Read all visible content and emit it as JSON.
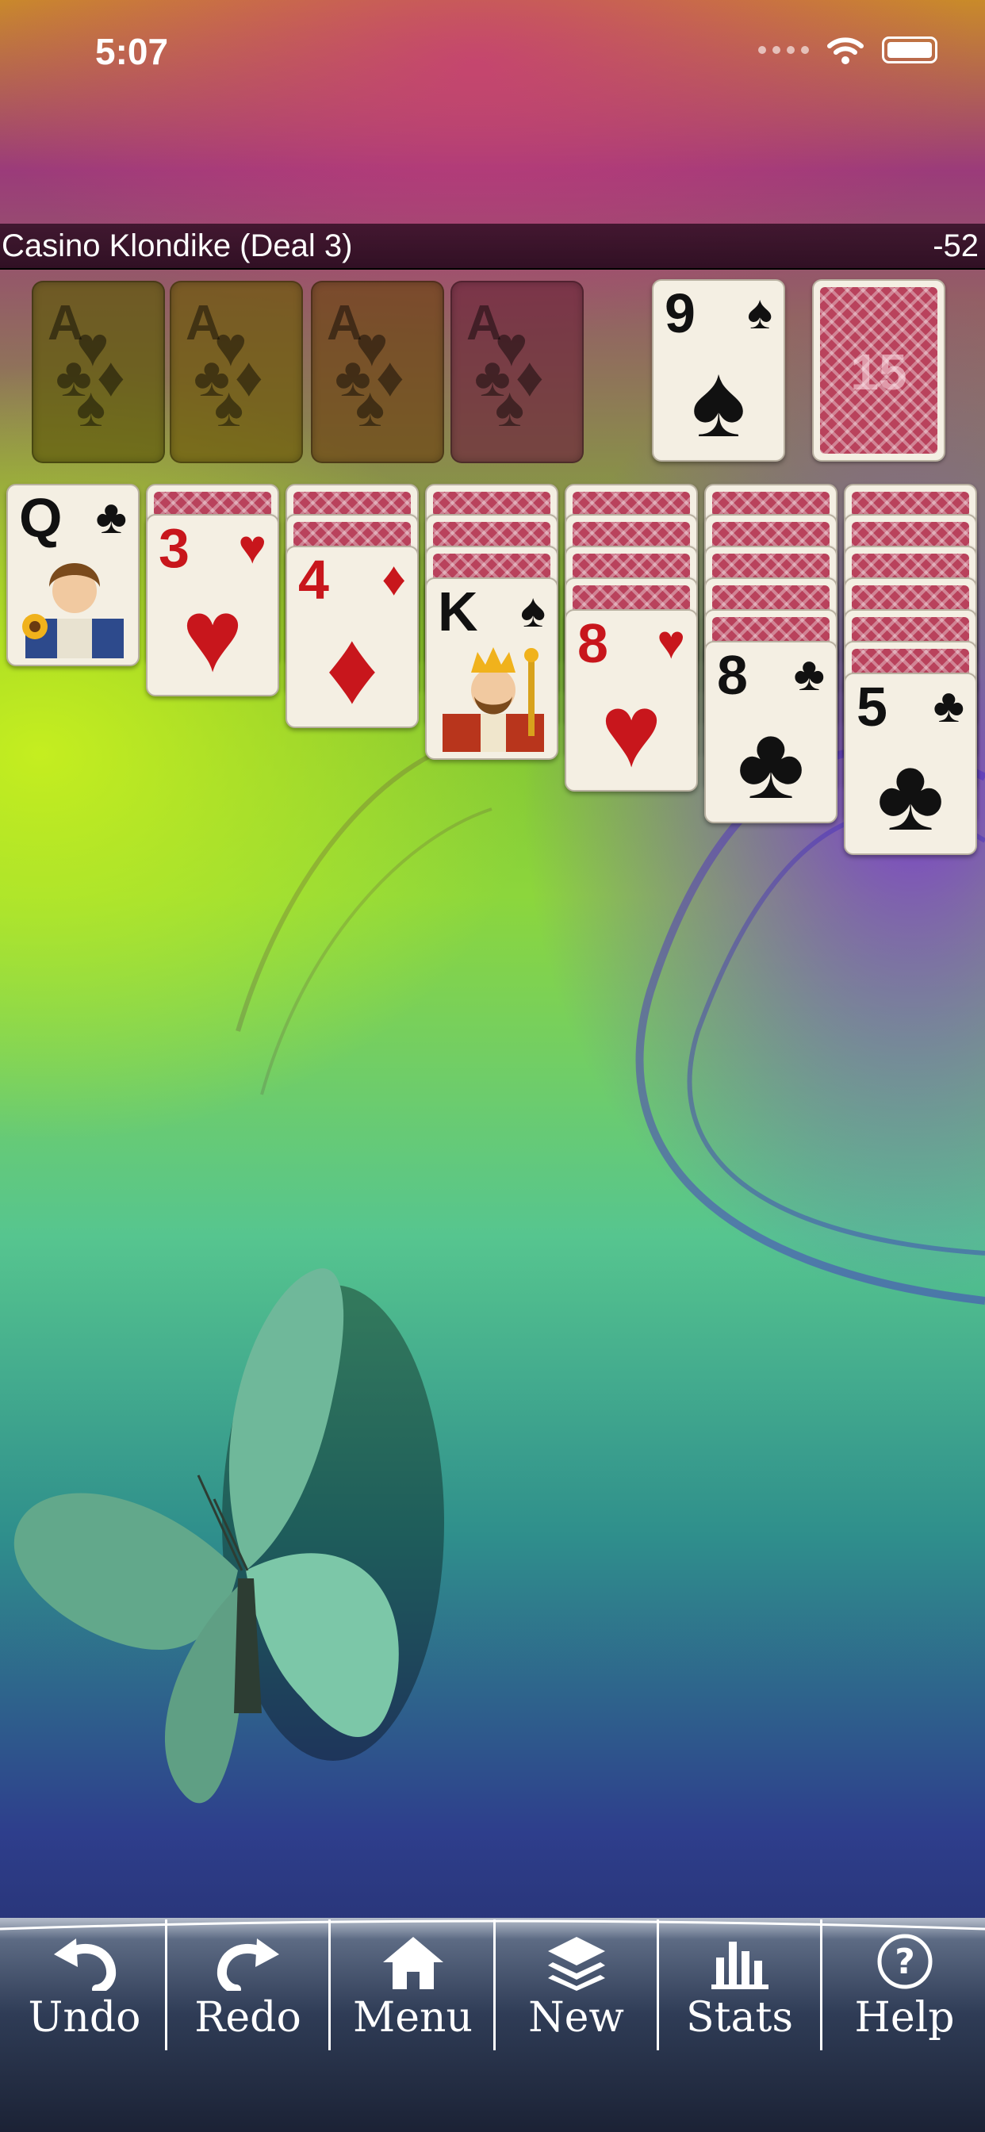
{
  "status_bar": {
    "time": "5:07"
  },
  "game": {
    "title": "Casino Klondike (Deal 3)",
    "score": "-52"
  },
  "foundations": [
    {
      "label": "A",
      "tint": "#6b6a10"
    },
    {
      "label": "A",
      "tint": "#6b5a12"
    },
    {
      "label": "A",
      "tint": "#6b4016"
    },
    {
      "label": "A",
      "tint": "#6b2a3a"
    }
  ],
  "waste": {
    "rank": "9",
    "suit": "♠",
    "color": "black"
  },
  "stock": {
    "count": "15"
  },
  "tableau": [
    {
      "hidden": 0,
      "top": {
        "rank": "Q",
        "suit": "♣",
        "face_icon": "queen-face"
      }
    },
    {
      "hidden": 1,
      "top": {
        "rank": "3",
        "suit": "♥"
      }
    },
    {
      "hidden": 2,
      "top": {
        "rank": "4",
        "suit": "♦"
      }
    },
    {
      "hidden": 3,
      "top": {
        "rank": "K",
        "suit": "♠",
        "face_icon": "king-face"
      }
    },
    {
      "hidden": 4,
      "top": {
        "rank": "8",
        "suit": "♥"
      }
    },
    {
      "hidden": 5,
      "top": {
        "rank": "8",
        "suit": "♣"
      }
    },
    {
      "hidden": 6,
      "top": {
        "rank": "5",
        "suit": "♣"
      }
    }
  ],
  "toolbar": {
    "undo": "Undo",
    "redo": "Redo",
    "menu": "Menu",
    "new": "New",
    "stats": "Stats",
    "help": "Help"
  },
  "colors": {
    "red_suit": "#c8161c",
    "black_suit": "#111111",
    "card_face": "#f4efe3",
    "card_back": "#b9425c"
  }
}
